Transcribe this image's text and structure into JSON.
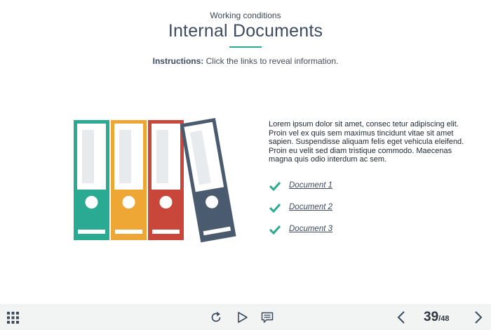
{
  "header": {
    "subtitle": "Working conditions",
    "title": "Internal Documents",
    "instructions_label": "Instructions:",
    "instructions_text": "Click the links to reveal information."
  },
  "content": {
    "body": "Lorem ipsum dolor sit amet, consec tetur adipiscing elit. Proin vel ex quis sem maximus tincidunt vitae sit amet sapien. Suspendisse aliquam felis eget vehicula eleifend. Proin eu velit sed diam tristique commodo. Maecenas magna quis odio interdum ac sem.",
    "documents": [
      {
        "label": "Document  1"
      },
      {
        "label": "Document  2"
      },
      {
        "label": "Document  3"
      }
    ]
  },
  "illustration": {
    "binder_colors": [
      "#2aaa92",
      "#eea735",
      "#c9473a",
      "#4a5b70"
    ]
  },
  "colors": {
    "accent": "#2aaa92",
    "title": "#3d4b61",
    "footer_bg": "#f2f3f3"
  },
  "footer": {
    "current_page": "39",
    "total_pages": "/48",
    "icons": [
      "grid-menu-icon",
      "replay-icon",
      "play-icon",
      "comment-icon",
      "prev-icon",
      "next-icon"
    ]
  }
}
